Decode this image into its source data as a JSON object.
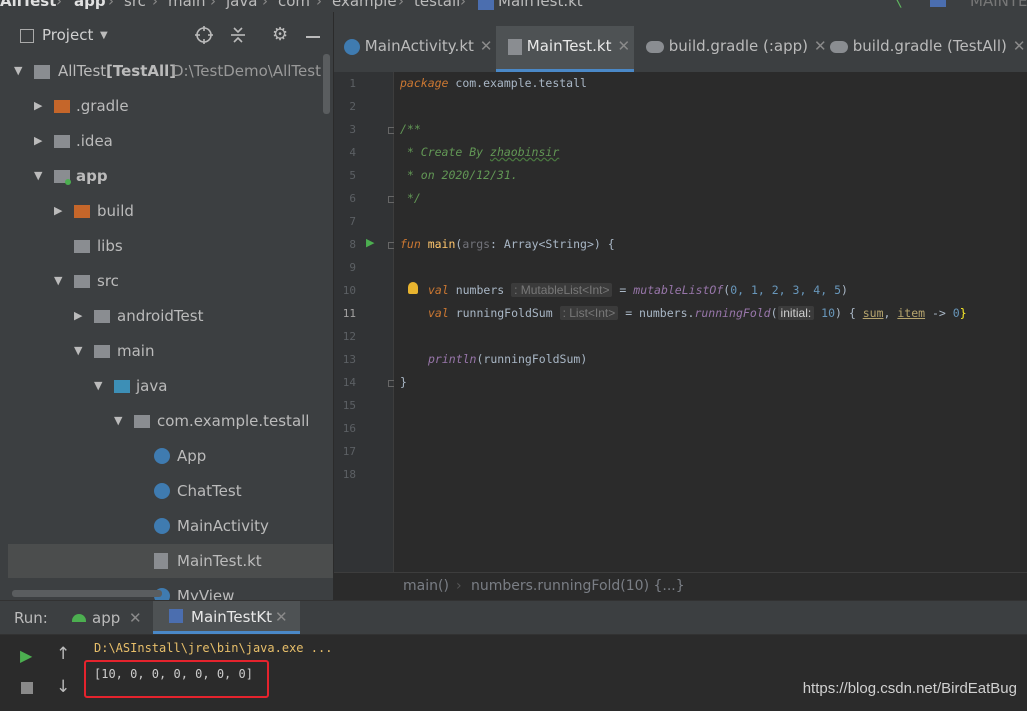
{
  "breadcrumb": {
    "items": [
      "AllTest",
      "app",
      "src",
      "main",
      "java",
      "com",
      "example",
      "testall",
      "MainTest.kt"
    ],
    "right_label": "MAINTE"
  },
  "project_panel": {
    "title": "Project",
    "tree": [
      {
        "label": "AllTest",
        "suffix": "[TestAll]",
        "path": "D:\\TestDemo\\AllTest"
      },
      {
        "label": ".gradle"
      },
      {
        "label": ".idea"
      },
      {
        "label": "app"
      },
      {
        "label": "build"
      },
      {
        "label": "libs"
      },
      {
        "label": "src"
      },
      {
        "label": "androidTest"
      },
      {
        "label": "main"
      },
      {
        "label": "java"
      },
      {
        "label": "com.example.testall"
      },
      {
        "label": "App"
      },
      {
        "label": "ChatTest"
      },
      {
        "label": "MainActivity"
      },
      {
        "label": "MainTest.kt"
      },
      {
        "label": "MyView"
      }
    ]
  },
  "editor": {
    "tabs": [
      {
        "label": "MainActivity.kt"
      },
      {
        "label": "MainTest.kt"
      },
      {
        "label": "build.gradle (:app)"
      },
      {
        "label": "build.gradle (TestAll)"
      }
    ],
    "line_numbers": [
      "1",
      "2",
      "3",
      "4",
      "5",
      "6",
      "7",
      "8",
      "9",
      "10",
      "11",
      "12",
      "13",
      "14",
      "15",
      "16",
      "17",
      "18"
    ],
    "code": {
      "l1_kw": "package",
      "l1_rest": " com.example.testall",
      "l3": "/**",
      "l4a": " * Create By ",
      "l4b": "zhaobinsir",
      "l5": " * on 2020/12/31.",
      "l6": " */",
      "l8_fun": "fun",
      "l8_main": " main",
      "l8_p1": "(",
      "l8_args": "args",
      "l8_rest": ": Array<String>) {",
      "l10_val": "val",
      "l10_name": " numbers ",
      "l10_hint": ": MutableList<Int>",
      "l10_eq": " = ",
      "l10_fn": "mutableListOf",
      "l10_open": "(",
      "l10_nums": "0, 1, 2, 3, 4, 5",
      "l10_close": ")",
      "l11_val": "val",
      "l11_name": " runningFoldSum ",
      "l11_hint": ": List<Int>",
      "l11_eq": " = numbers.",
      "l11_fn": "runningFold",
      "l11_open": "(",
      "l11_phint": "initial:",
      "l11_num": " 10",
      "l11_mid": ") { ",
      "l11_sum": "sum",
      "l11_comma": ", ",
      "l11_item": "item",
      "l11_arrow": " -> ",
      "l11_zero": "0",
      "l11_end": "}",
      "l13_fn": "println",
      "l13_rest": "(runningFoldSum)",
      "l14": "}"
    },
    "breadcrumb": [
      "main()",
      "numbers.runningFold(10) {...}"
    ]
  },
  "run_panel": {
    "label": "Run:",
    "tabs": [
      {
        "label": "app"
      },
      {
        "label": "MainTestKt"
      }
    ],
    "console": {
      "command": "D:\\ASInstall\\jre\\bin\\java.exe ...",
      "output": "[10, 0, 0, 0, 0, 0, 0]"
    }
  },
  "watermark": "https://blog.csdn.net/BirdEatBug",
  "colors": {
    "accent": "#4a88c7",
    "highlight_box": "#e5232d",
    "run_green": "#4caf50",
    "keyword": "#cc7832",
    "comment": "#629755",
    "number": "#6897bb"
  }
}
